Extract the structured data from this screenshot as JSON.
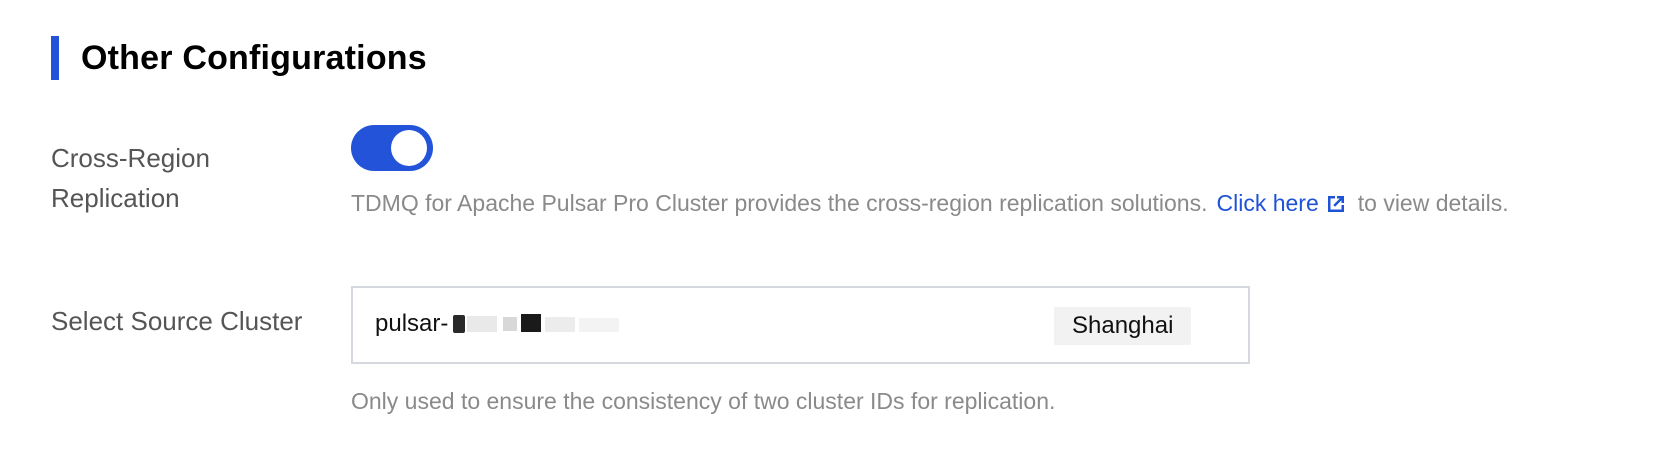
{
  "section": {
    "title": "Other Configurations",
    "accent_color": "#2353d8"
  },
  "cross_region": {
    "label": "Cross-Region Replication",
    "toggle_on": true,
    "help_prefix": "TDMQ for Apache Pulsar Pro Cluster provides the cross-region replication solutions.",
    "link_text": "Click here",
    "link_icon": "external-link-icon",
    "help_suffix": "to view details."
  },
  "source_cluster": {
    "label": "Select Source Cluster",
    "value": "pulsar-",
    "region": "Shanghai",
    "help": "Only used to ensure the consistency of two cluster IDs for replication."
  }
}
